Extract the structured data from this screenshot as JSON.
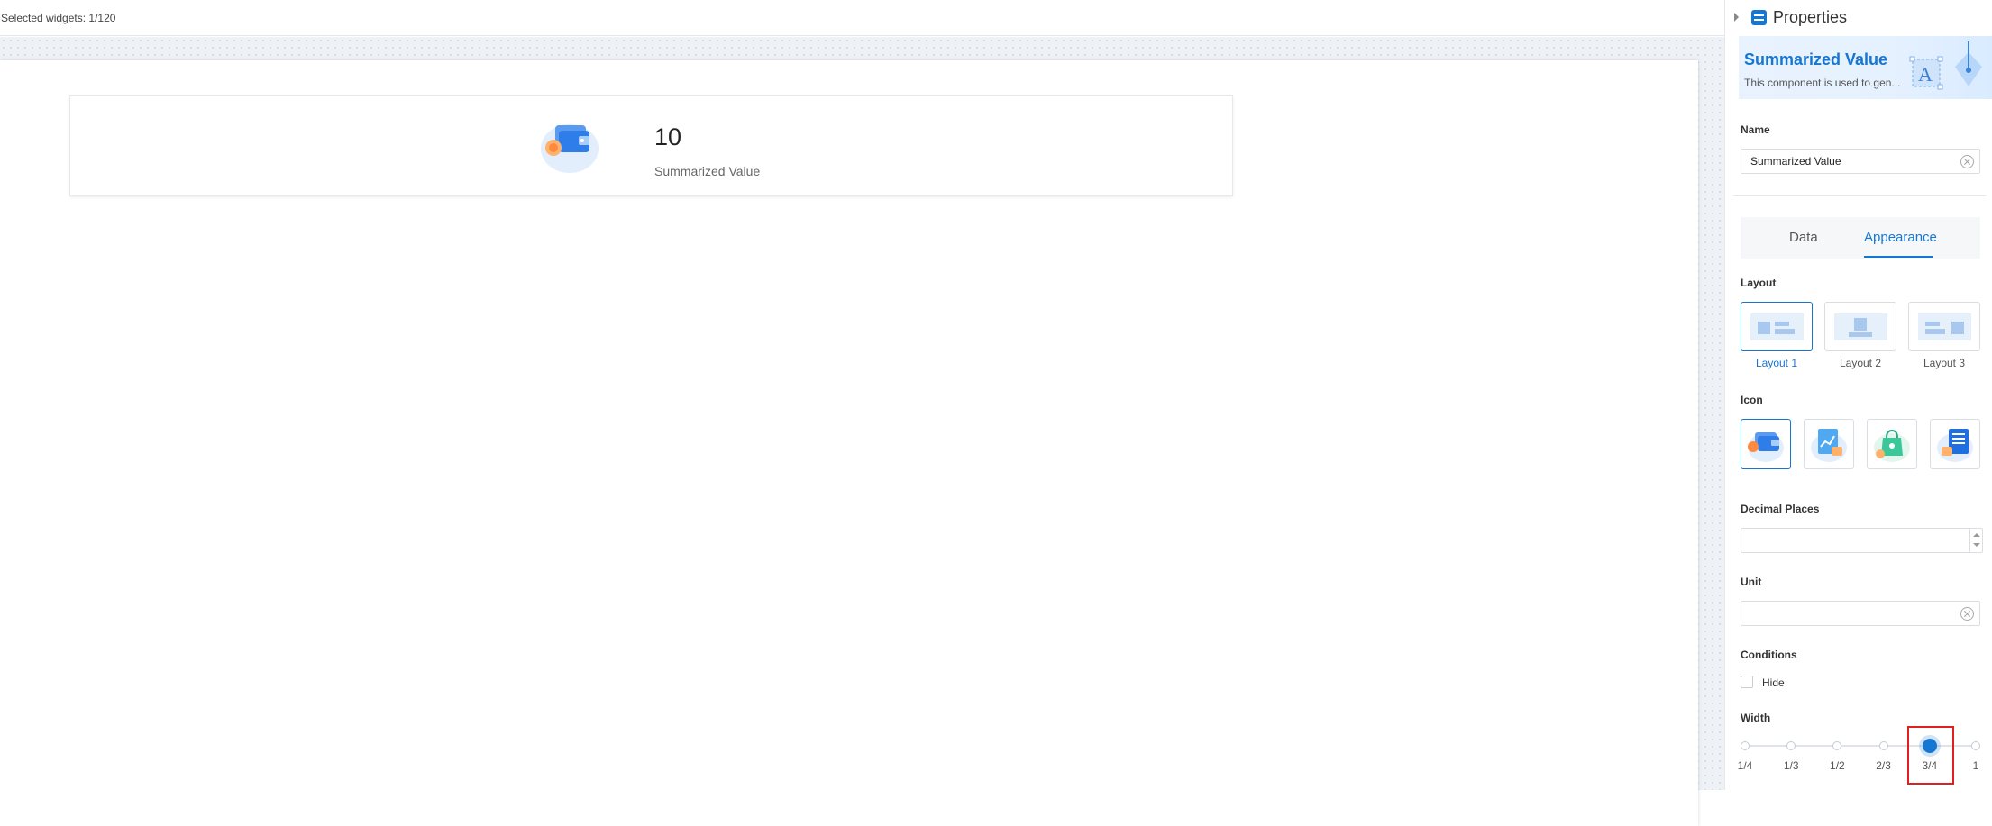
{
  "topbar": {
    "selected_text": "Selected widgets: 1/120"
  },
  "widget": {
    "value": "10",
    "label": "Summarized Value"
  },
  "panel": {
    "title": "Properties",
    "banner": {
      "title": "Summarized Value",
      "description": "This component is used to gen..."
    },
    "name_section": {
      "label": "Name",
      "value": "Summarized Value"
    },
    "tabs": [
      {
        "label": "Data",
        "active": false
      },
      {
        "label": "Appearance",
        "active": true
      }
    ],
    "layout_section": {
      "label": "Layout",
      "options": [
        {
          "label": "Layout 1",
          "selected": true
        },
        {
          "label": "Layout 2",
          "selected": false
        },
        {
          "label": "Layout 3",
          "selected": false
        }
      ]
    },
    "icon_section": {
      "label": "Icon",
      "options": [
        {
          "icon": "wallet-icon",
          "selected": true
        },
        {
          "icon": "chart-document-icon",
          "selected": false
        },
        {
          "icon": "shopping-bag-icon",
          "selected": false
        },
        {
          "icon": "document-list-icon",
          "selected": false
        }
      ]
    },
    "decimal_section": {
      "label": "Decimal Places",
      "value": ""
    },
    "unit_section": {
      "label": "Unit",
      "value": ""
    },
    "conditions_section": {
      "label": "Conditions",
      "hide_label": "Hide",
      "hide_checked": false
    },
    "width_section": {
      "label": "Width",
      "stops": [
        "1/4",
        "1/3",
        "1/2",
        "2/3",
        "3/4",
        "1"
      ],
      "selected": "3/4"
    }
  },
  "colors": {
    "accent": "#1677d2",
    "highlight": "#e02020"
  }
}
